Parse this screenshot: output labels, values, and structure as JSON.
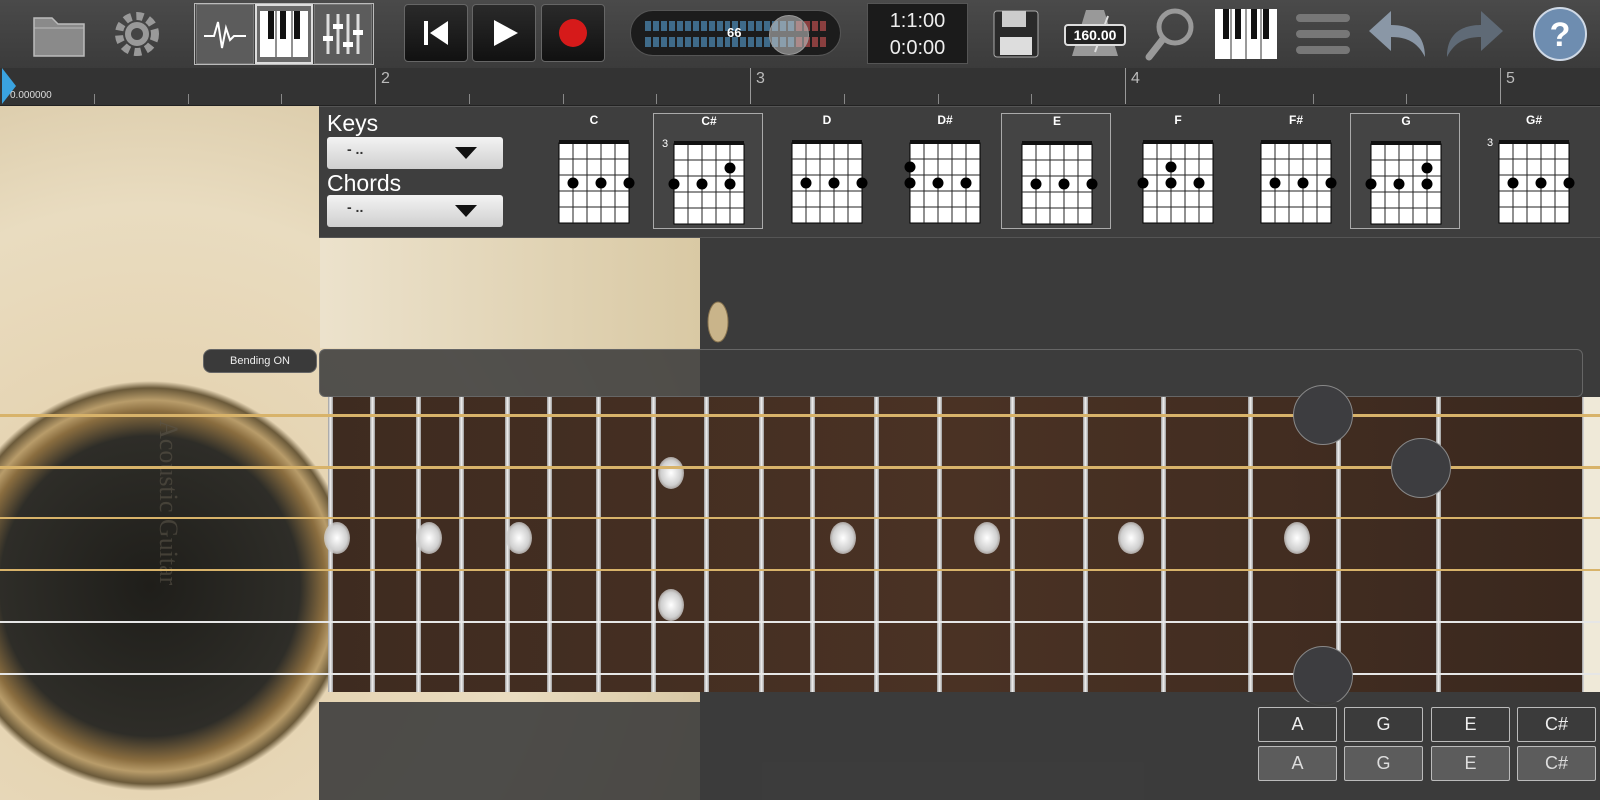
{
  "toolbar": {
    "icons": [
      "folder-icon",
      "gear-icon",
      "waveform-icon",
      "piano-icon",
      "mixer-icon",
      "rewind-icon",
      "play-icon",
      "record-icon",
      "save-icon",
      "metronome-icon",
      "zoom-icon",
      "keyboard-icon",
      "menu-icon",
      "undo-icon",
      "redo-icon",
      "help-icon"
    ],
    "volume_value": "66",
    "time_bars": "1:1:00",
    "time_clock": "0:0:00",
    "tempo": "160.00",
    "accent_record": "#d61a1a"
  },
  "ruler": {
    "position": "0.000000",
    "bar_numbers": [
      "2",
      "3",
      "4",
      "5"
    ]
  },
  "chord_panel": {
    "keys_label": "Keys",
    "chords_label": "Chords",
    "keys_value": "- ..",
    "chords_value": "- ..",
    "chords": [
      {
        "name": "C"
      },
      {
        "name": "C#",
        "fret_label": "3"
      },
      {
        "name": "D"
      },
      {
        "name": "D#"
      },
      {
        "name": "E"
      },
      {
        "name": "F"
      },
      {
        "name": "F#"
      },
      {
        "name": "G"
      },
      {
        "name": "G#",
        "fret_label": "3"
      }
    ]
  },
  "bending_label": "Bending ON",
  "soundhole_text": "Acoustic Guitar",
  "string_buttons_top": [
    "A",
    "G",
    "E",
    "C#"
  ],
  "string_buttons_bottom": [
    "A",
    "G",
    "E",
    "C#"
  ]
}
